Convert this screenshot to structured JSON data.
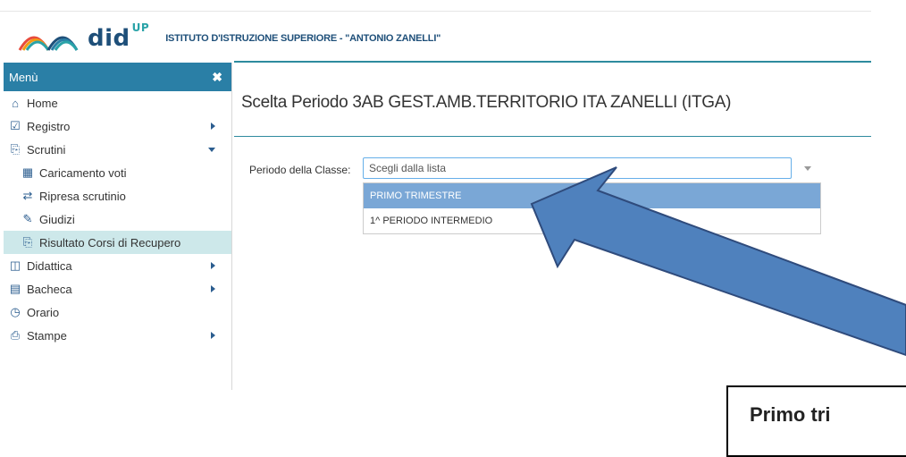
{
  "header": {
    "brand": "did",
    "brand_sup": "UP",
    "school": "ISTITUTO D'ISTRUZIONE SUPERIORE - \"ANTONIO ZANELLI\""
  },
  "sidebar": {
    "title": "Menù",
    "items": [
      {
        "label": "Home",
        "icon": "home-icon"
      },
      {
        "label": "Registro",
        "icon": "calendar-icon"
      },
      {
        "label": "Scrutini",
        "icon": "scrutini-icon"
      },
      {
        "label": "Caricamento voti",
        "icon": "grid-icon"
      },
      {
        "label": "Ripresa scrutinio",
        "icon": "refresh-icon"
      },
      {
        "label": "Giudizi",
        "icon": "edit-icon"
      },
      {
        "label": "Risultato Corsi di Recupero",
        "icon": "scrutini-icon"
      },
      {
        "label": "Didattica",
        "icon": "book-icon"
      },
      {
        "label": "Bacheca",
        "icon": "board-icon"
      },
      {
        "label": "Orario",
        "icon": "clock-icon"
      },
      {
        "label": "Stampe",
        "icon": "print-icon"
      }
    ]
  },
  "main": {
    "title": "Scelta Periodo 3AB GEST.AMB.TERRITORIO ITA ZANELLI (ITGA)",
    "field_label": "Periodo della Classe:",
    "select_placeholder": "Scegli dalla lista",
    "options": [
      "PRIMO TRIMESTRE",
      "1^ PERIODO INTERMEDIO"
    ]
  },
  "callout": {
    "text": "Primo tri"
  },
  "colors": {
    "menu_header": "#2a7fa6",
    "active_item": "#cde8ea",
    "selected_option": "#7aa7d6",
    "arrow": "#4f81bd"
  }
}
